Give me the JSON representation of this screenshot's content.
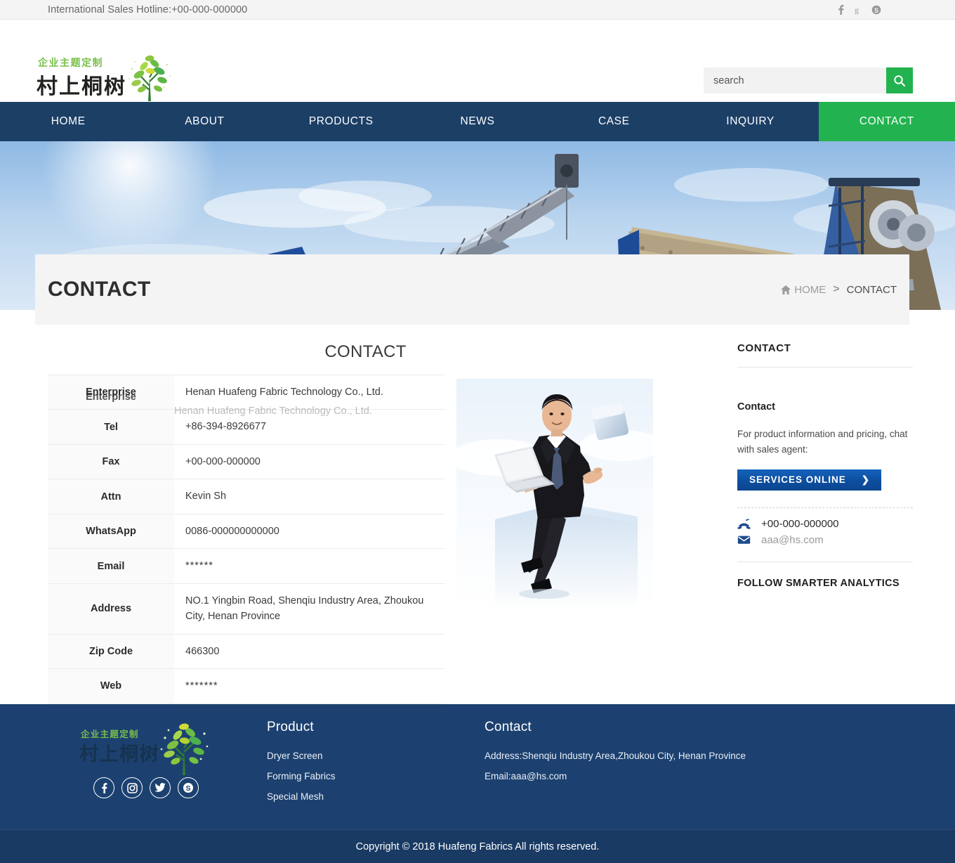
{
  "topbar": {
    "hotline": "International Sales Hotline:+00-000-000000",
    "social": [
      {
        "name": "facebook-icon",
        "glyph": "f"
      },
      {
        "name": "google-plus-icon",
        "glyph": "g"
      },
      {
        "name": "skype-icon",
        "glyph": "s"
      }
    ]
  },
  "header": {
    "logo": {
      "tagline_cn": "企业主题定制",
      "name_cn": "村上桐树",
      "icon": "tree-logo"
    },
    "search": {
      "placeholder": "search",
      "value": "",
      "button_icon": "search-icon"
    }
  },
  "nav": {
    "items": [
      {
        "label": "HOME",
        "active": false
      },
      {
        "label": "ABOUT",
        "active": false
      },
      {
        "label": "PRODUCTS",
        "active": false
      },
      {
        "label": "NEWS",
        "active": false
      },
      {
        "label": "CASE",
        "active": false
      },
      {
        "label": "INQUIRY",
        "active": false
      },
      {
        "label": "CONTACT",
        "active": true
      }
    ],
    "active_bg": "#22b24f",
    "bg": "#1c3f66"
  },
  "banner": {
    "alt": "industrial conveyor and crushing machinery against blue sky"
  },
  "titlebar": {
    "title": "CONTACT",
    "breadcrumb": {
      "home": "HOME",
      "separator": ">",
      "current": "CONTACT",
      "home_icon": "home-icon"
    }
  },
  "content": {
    "heading": "CONTACT",
    "table": {
      "rows": [
        {
          "label": "Enterprise",
          "value": "Henan Huafeng Fabric Technology Co., Ltd.",
          "ghost": true
        },
        {
          "label": "Tel",
          "value": "+86-394-8926677"
        },
        {
          "label": "Fax",
          "value": "+00-000-000000"
        },
        {
          "label": "Attn",
          "value": "Kevin Sh"
        },
        {
          "label": "WhatsApp",
          "value": " 0086-000000000000"
        },
        {
          "label": "Email",
          "value": "******",
          "masked": true
        },
        {
          "label": "Address",
          "value": "NO.1 Yingbin Road, Shenqiu Industry Area, Zhoukou City, Henan Province"
        },
        {
          "label": "Zip Code",
          "value": "466300"
        },
        {
          "label": "Web",
          "value": "*******",
          "masked": true
        }
      ]
    },
    "image": {
      "name": "businessman-with-laptop-image"
    }
  },
  "sidebar": {
    "title": "CONTACT",
    "subtitle": "Contact",
    "description": "For product information and pricing, chat with sales agent:",
    "cta_label": "SERVICES  ONLINE",
    "cta_arrow": "❯",
    "phone": "+00-000-000000",
    "email": "aaa@hs.com",
    "phone_icon": "telephone-icon",
    "email_icon": "envelope-icon",
    "follow_title": "FOLLOW SMARTER ANALYTICS"
  },
  "footer": {
    "logo": {
      "tagline_cn": "企业主题定制",
      "name_cn": "村上桐树",
      "icon": "tree-logo"
    },
    "social": [
      {
        "name": "facebook-icon",
        "glyph": "f"
      },
      {
        "name": "instagram-icon",
        "glyph": "i"
      },
      {
        "name": "twitter-icon",
        "glyph": "t"
      },
      {
        "name": "skype-icon",
        "glyph": "s"
      }
    ],
    "product": {
      "title": "Product",
      "items": [
        "Dryer Screen",
        "Forming Fabrics",
        "Special Mesh"
      ]
    },
    "contact": {
      "title": "Contact",
      "address": "Address:Shenqiu Industry Area,Zhoukou City, Henan Province",
      "email": "Email:aaa@hs.com"
    },
    "copyright": "Copyright © 2018 Huafeng Fabrics All rights reserved."
  }
}
